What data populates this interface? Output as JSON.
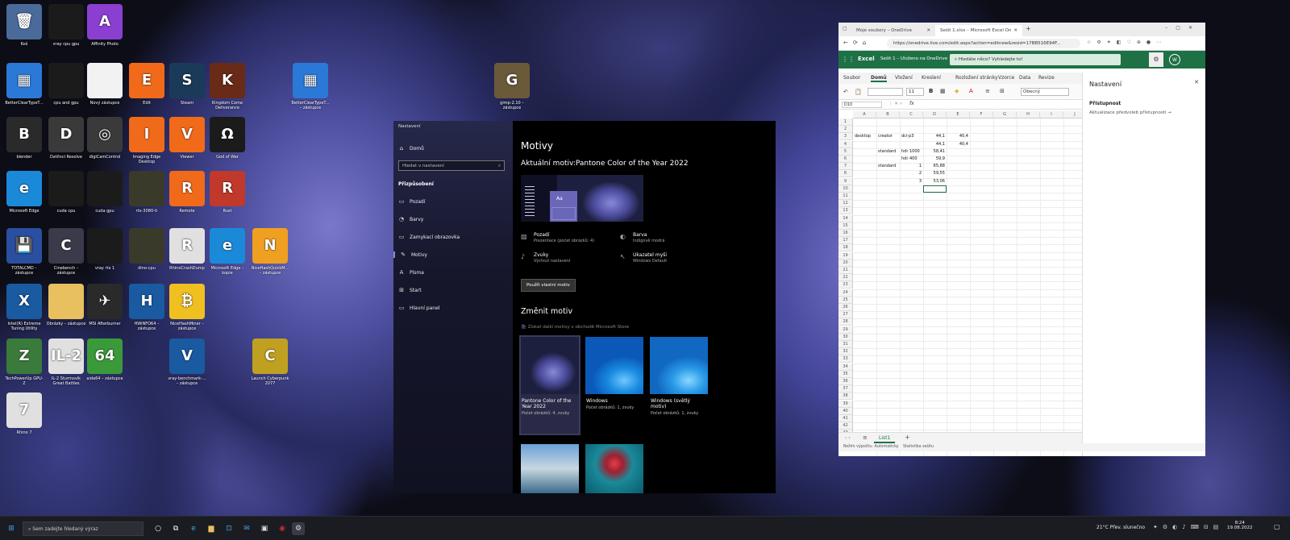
{
  "desktop": {
    "icons": [
      {
        "label": "Koš",
        "color": "#4a6a9a",
        "glyph": "🗑"
      },
      {
        "label": "vray cpu gpu",
        "color": "#1b1b1b",
        "glyph": ""
      },
      {
        "label": "Affinity Photo",
        "color": "#8a3fd0",
        "glyph": "A"
      },
      {
        "label": "BetterClearTypeT...",
        "color": "#2b79d6",
        "glyph": "▦"
      },
      {
        "label": "cpu and gpu",
        "color": "#1b1b1b",
        "glyph": ""
      },
      {
        "label": "Nový zástupce",
        "color": "#f2f2f2",
        "glyph": ""
      },
      {
        "label": "Edit",
        "color": "#f06a1a",
        "glyph": "E"
      },
      {
        "label": "Steam",
        "color": "#1b3a5a",
        "glyph": "S"
      },
      {
        "label": "Kingdom Come Deliverance",
        "color": "#6a2a18",
        "glyph": "K"
      },
      {
        "label": "BetterClearTypeT... – zástupce",
        "color": "#2b79d6",
        "glyph": "▦"
      },
      {
        "label": "blender",
        "color": "#2a2a2a",
        "glyph": "B"
      },
      {
        "label": "DaVinci Resolve",
        "color": "#3a3a3a",
        "glyph": "D"
      },
      {
        "label": "digiCamControl",
        "color": "#3a3a3a",
        "glyph": "◎"
      },
      {
        "label": "Imaging Edge Desktop",
        "color": "#f06a1a",
        "glyph": "I"
      },
      {
        "label": "Viewer",
        "color": "#f06a1a",
        "glyph": "V"
      },
      {
        "label": "God of War",
        "color": "#1b1b1b",
        "glyph": "Ω"
      },
      {
        "label": "Microsoft Edge",
        "color": "#1a8ad8",
        "glyph": "e"
      },
      {
        "label": "cuda cpu",
        "color": "#1b1b1b",
        "glyph": ""
      },
      {
        "label": "cuda gpu",
        "color": "#1b1b1b",
        "glyph": ""
      },
      {
        "label": "rtx-3080-ti",
        "color": "#3a3a2a",
        "glyph": ""
      },
      {
        "label": "Remote",
        "color": "#f06a1a",
        "glyph": "R"
      },
      {
        "label": "Rust",
        "color": "#c0392b",
        "glyph": "R"
      },
      {
        "label": "TOTALCMD – zástupce",
        "color": "#2b4fa0",
        "glyph": "💾"
      },
      {
        "label": "Cinebench – zástupce",
        "color": "#3a3a4a",
        "glyph": "C"
      },
      {
        "label": "vray rtx 1",
        "color": "#1b1b1b",
        "glyph": ""
      },
      {
        "label": "dino-cpu",
        "color": "#3a3a2a",
        "glyph": ""
      },
      {
        "label": "RhinoCrashDump",
        "color": "#e0e0e0",
        "glyph": "R"
      },
      {
        "label": "Microsoft Edge – kopie",
        "color": "#1a8ad8",
        "glyph": "e"
      },
      {
        "label": "NiceHashQuickM... – zástupce",
        "color": "#f0a020",
        "glyph": "N"
      },
      {
        "label": "Intel(R) Extreme Tuning Utility",
        "color": "#1a5aa0",
        "glyph": "X"
      },
      {
        "label": "Obrázky – zástupce",
        "color": "#e8c060",
        "glyph": ""
      },
      {
        "label": "MSI Afterburner",
        "color": "#2a2a2a",
        "glyph": "✈"
      },
      {
        "label": "HWiNFO64 – zástupce",
        "color": "#1a5aa0",
        "glyph": "H"
      },
      {
        "label": "NiceHashMiner – zástupce",
        "color": "#f0c020",
        "glyph": "₿"
      },
      {
        "label": "TechPowerUp GPU-Z",
        "color": "#3a7a3a",
        "glyph": "Z"
      },
      {
        "label": "IL-2 Sturmovik Great Battles",
        "color": "#e0e0e0",
        "glyph": "IL-2"
      },
      {
        "label": "aida64 – zástupce",
        "color": "#3a9a3a",
        "glyph": "64"
      },
      {
        "label": "vray-benchmark-... – zástupce",
        "color": "#1a5aa0",
        "glyph": "V"
      },
      {
        "label": "Launch Cyberpunk 2077",
        "color": "#c0a020",
        "glyph": "C"
      },
      {
        "label": "Rhino 7",
        "color": "#e0e0e0",
        "glyph": "7"
      },
      {
        "label": "gimp-2.10 – zástupce",
        "color": "#6a5a3a",
        "glyph": "G"
      }
    ]
  },
  "settings": {
    "window_title": "Nastavení",
    "nav_home": "Domů",
    "search_placeholder": "Hledat v nastavení",
    "section": "Přizpůsobení",
    "nav": [
      "Pozadí",
      "Barvy",
      "Zamykací obrazovka",
      "Motivy",
      "Písma",
      "Start",
      "Hlavní panel"
    ],
    "page_title": "Motivy",
    "current_theme": "Aktuální motiv:Pantone Color of the Year 2022",
    "preview_aa": "Aa",
    "tiles": [
      {
        "name": "Pozadí",
        "sub": "Prezentace (počet obrázků: 4)"
      },
      {
        "name": "Barva",
        "sub": "Indigově modrá"
      },
      {
        "name": "Zvuky",
        "sub": "Výchozí nastavení"
      },
      {
        "name": "Ukazatel myši",
        "sub": "Windows Default"
      }
    ],
    "use_custom": "Použít vlastní motiv",
    "change_theme": "Změnit motiv",
    "store_link": "Získat další motivy v obchodě Microsoft Store",
    "themes": [
      {
        "name": "Pantone Color of the Year 2022",
        "desc": "Počet obrázků: 4, zvuky"
      },
      {
        "name": "Windows",
        "desc": "Počet obrázků: 1, zvuky"
      },
      {
        "name": "Windows (světlý motiv)",
        "desc": "Počet obrázků: 1, zvuky"
      }
    ]
  },
  "excel": {
    "browser_tabs": [
      "Moje soubory – OneDrive",
      "Sešit 1.xlsx – Microsoft Excel Online"
    ],
    "url": "https://onedrive.live.com/edit.aspx?action=editnew&resid=17BB516E94F...",
    "app": "Excel",
    "doc": "Sešit 1 – Uloženo na OneDrive",
    "search": "Hledáte něco? Vyhledejte to!",
    "avatar": "W",
    "ribbon_tabs": [
      "Soubor",
      "Domů",
      "Vložení",
      "Kreslení",
      "Rozložení stránky",
      "Vzorce",
      "Data",
      "Revize"
    ],
    "font_size": "11",
    "number_format": "Obecný",
    "name_box": "D10",
    "fx": "fx",
    "columns": [
      "A",
      "B",
      "C",
      "D",
      "E",
      "F",
      "G",
      "H",
      "I",
      "J"
    ],
    "rows": [
      "1",
      "2",
      "3",
      "4",
      "5",
      "6",
      "7",
      "8",
      "9",
      "10",
      "11",
      "12",
      "13",
      "14",
      "15",
      "16",
      "17",
      "18",
      "19",
      "20",
      "21",
      "22",
      "23",
      "24",
      "25",
      "26",
      "27",
      "28",
      "29",
      "30",
      "31",
      "32",
      "33",
      "34",
      "35",
      "36",
      "37",
      "38",
      "39",
      "40",
      "41",
      "42",
      "43",
      "44"
    ],
    "cells": [
      {
        "r": 3,
        "c": 0,
        "v": "desktop"
      },
      {
        "r": 3,
        "c": 1,
        "v": "creator"
      },
      {
        "r": 3,
        "c": 2,
        "v": "dci-p3"
      },
      {
        "r": 3,
        "c": 3,
        "v": "44,1",
        "n": true
      },
      {
        "r": 3,
        "c": 4,
        "v": "40,4",
        "n": true
      },
      {
        "r": 4,
        "c": 3,
        "v": "44,1",
        "n": true
      },
      {
        "r": 4,
        "c": 4,
        "v": "40,4",
        "n": true
      },
      {
        "r": 5,
        "c": 1,
        "v": "standard"
      },
      {
        "r": 5,
        "c": 2,
        "v": "hdr 1000"
      },
      {
        "r": 5,
        "c": 3,
        "v": "58,41",
        "n": true
      },
      {
        "r": 6,
        "c": 2,
        "v": "hdr 400"
      },
      {
        "r": 6,
        "c": 3,
        "v": "59,9",
        "n": true
      },
      {
        "r": 7,
        "c": 1,
        "v": "standard"
      },
      {
        "r": 7,
        "c": 2,
        "v": "1",
        "n": true
      },
      {
        "r": 7,
        "c": 3,
        "v": "65,88",
        "n": true
      },
      {
        "r": 8,
        "c": 2,
        "v": "2",
        "n": true
      },
      {
        "r": 8,
        "c": 3,
        "v": "59,55",
        "n": true
      },
      {
        "r": 9,
        "c": 2,
        "v": "3",
        "n": true
      },
      {
        "r": 9,
        "c": 3,
        "v": "53,06",
        "n": true
      }
    ],
    "pane_title": "Nastavení",
    "pane_section": "Přístupnost",
    "pane_link": "Aktualizace předvoleb přístupnosti",
    "sheet": "List1",
    "status_left": "Režim výpočtu: Automaticky",
    "status_right": "Statistika sešitu"
  },
  "taskbar": {
    "search": "Sem zadejte hledaný výraz",
    "weather": "21°C  Přev. slunečno",
    "time": "8:24",
    "date": "19.08.2022"
  }
}
